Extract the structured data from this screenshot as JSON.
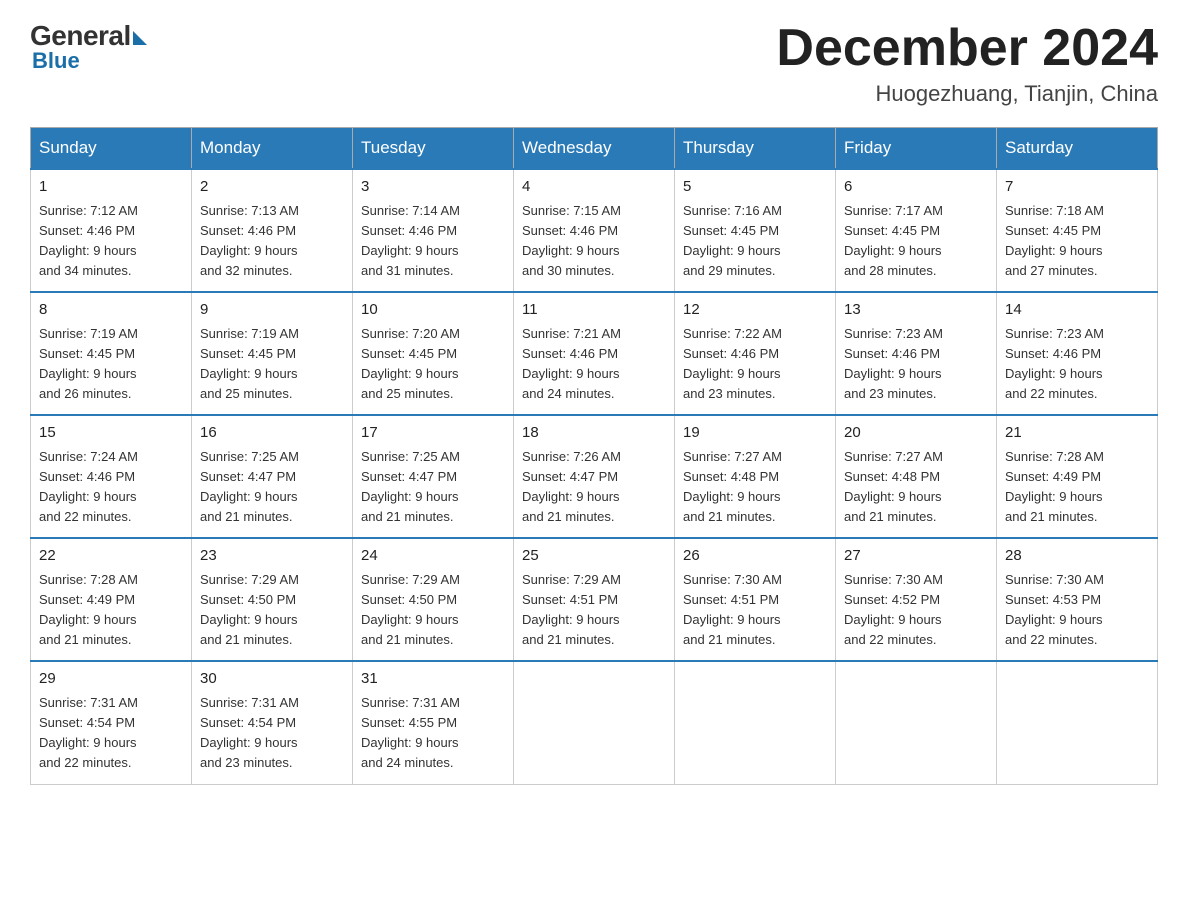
{
  "header": {
    "logo_general": "General",
    "logo_blue": "Blue",
    "month_title": "December 2024",
    "location": "Huogezhuang, Tianjin, China"
  },
  "days_of_week": [
    "Sunday",
    "Monday",
    "Tuesday",
    "Wednesday",
    "Thursday",
    "Friday",
    "Saturday"
  ],
  "weeks": [
    [
      {
        "day": "1",
        "sunrise": "7:12 AM",
        "sunset": "4:46 PM",
        "daylight": "9 hours and 34 minutes."
      },
      {
        "day": "2",
        "sunrise": "7:13 AM",
        "sunset": "4:46 PM",
        "daylight": "9 hours and 32 minutes."
      },
      {
        "day": "3",
        "sunrise": "7:14 AM",
        "sunset": "4:46 PM",
        "daylight": "9 hours and 31 minutes."
      },
      {
        "day": "4",
        "sunrise": "7:15 AM",
        "sunset": "4:46 PM",
        "daylight": "9 hours and 30 minutes."
      },
      {
        "day": "5",
        "sunrise": "7:16 AM",
        "sunset": "4:45 PM",
        "daylight": "9 hours and 29 minutes."
      },
      {
        "day": "6",
        "sunrise": "7:17 AM",
        "sunset": "4:45 PM",
        "daylight": "9 hours and 28 minutes."
      },
      {
        "day": "7",
        "sunrise": "7:18 AM",
        "sunset": "4:45 PM",
        "daylight": "9 hours and 27 minutes."
      }
    ],
    [
      {
        "day": "8",
        "sunrise": "7:19 AM",
        "sunset": "4:45 PM",
        "daylight": "9 hours and 26 minutes."
      },
      {
        "day": "9",
        "sunrise": "7:19 AM",
        "sunset": "4:45 PM",
        "daylight": "9 hours and 25 minutes."
      },
      {
        "day": "10",
        "sunrise": "7:20 AM",
        "sunset": "4:45 PM",
        "daylight": "9 hours and 25 minutes."
      },
      {
        "day": "11",
        "sunrise": "7:21 AM",
        "sunset": "4:46 PM",
        "daylight": "9 hours and 24 minutes."
      },
      {
        "day": "12",
        "sunrise": "7:22 AM",
        "sunset": "4:46 PM",
        "daylight": "9 hours and 23 minutes."
      },
      {
        "day": "13",
        "sunrise": "7:23 AM",
        "sunset": "4:46 PM",
        "daylight": "9 hours and 23 minutes."
      },
      {
        "day": "14",
        "sunrise": "7:23 AM",
        "sunset": "4:46 PM",
        "daylight": "9 hours and 22 minutes."
      }
    ],
    [
      {
        "day": "15",
        "sunrise": "7:24 AM",
        "sunset": "4:46 PM",
        "daylight": "9 hours and 22 minutes."
      },
      {
        "day": "16",
        "sunrise": "7:25 AM",
        "sunset": "4:47 PM",
        "daylight": "9 hours and 21 minutes."
      },
      {
        "day": "17",
        "sunrise": "7:25 AM",
        "sunset": "4:47 PM",
        "daylight": "9 hours and 21 minutes."
      },
      {
        "day": "18",
        "sunrise": "7:26 AM",
        "sunset": "4:47 PM",
        "daylight": "9 hours and 21 minutes."
      },
      {
        "day": "19",
        "sunrise": "7:27 AM",
        "sunset": "4:48 PM",
        "daylight": "9 hours and 21 minutes."
      },
      {
        "day": "20",
        "sunrise": "7:27 AM",
        "sunset": "4:48 PM",
        "daylight": "9 hours and 21 minutes."
      },
      {
        "day": "21",
        "sunrise": "7:28 AM",
        "sunset": "4:49 PM",
        "daylight": "9 hours and 21 minutes."
      }
    ],
    [
      {
        "day": "22",
        "sunrise": "7:28 AM",
        "sunset": "4:49 PM",
        "daylight": "9 hours and 21 minutes."
      },
      {
        "day": "23",
        "sunrise": "7:29 AM",
        "sunset": "4:50 PM",
        "daylight": "9 hours and 21 minutes."
      },
      {
        "day": "24",
        "sunrise": "7:29 AM",
        "sunset": "4:50 PM",
        "daylight": "9 hours and 21 minutes."
      },
      {
        "day": "25",
        "sunrise": "7:29 AM",
        "sunset": "4:51 PM",
        "daylight": "9 hours and 21 minutes."
      },
      {
        "day": "26",
        "sunrise": "7:30 AM",
        "sunset": "4:51 PM",
        "daylight": "9 hours and 21 minutes."
      },
      {
        "day": "27",
        "sunrise": "7:30 AM",
        "sunset": "4:52 PM",
        "daylight": "9 hours and 22 minutes."
      },
      {
        "day": "28",
        "sunrise": "7:30 AM",
        "sunset": "4:53 PM",
        "daylight": "9 hours and 22 minutes."
      }
    ],
    [
      {
        "day": "29",
        "sunrise": "7:31 AM",
        "sunset": "4:54 PM",
        "daylight": "9 hours and 22 minutes."
      },
      {
        "day": "30",
        "sunrise": "7:31 AM",
        "sunset": "4:54 PM",
        "daylight": "9 hours and 23 minutes."
      },
      {
        "day": "31",
        "sunrise": "7:31 AM",
        "sunset": "4:55 PM",
        "daylight": "9 hours and 24 minutes."
      },
      null,
      null,
      null,
      null
    ]
  ],
  "label_sunrise": "Sunrise:",
  "label_sunset": "Sunset:",
  "label_daylight": "Daylight:"
}
